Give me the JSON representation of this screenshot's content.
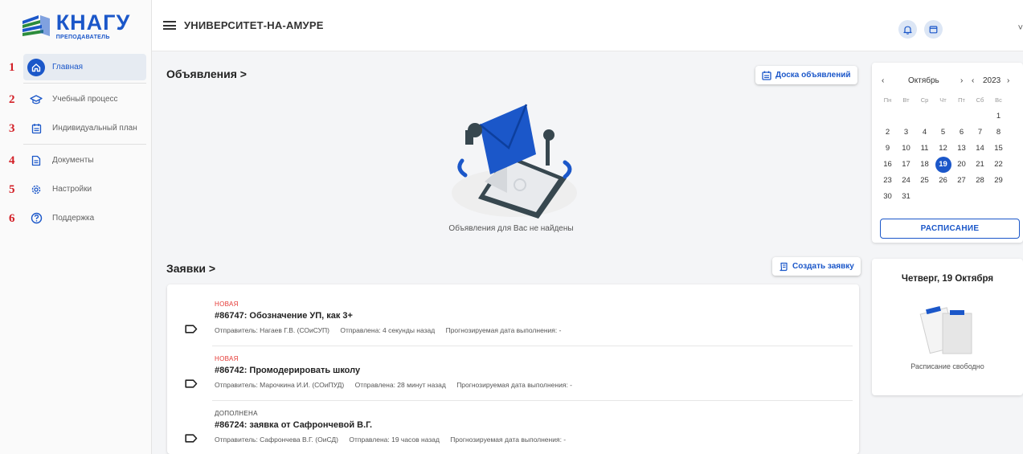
{
  "brand": {
    "logo_main": "КНАГУ",
    "logo_sub": "ПРЕПОДАВАТЕЛЬ"
  },
  "header": {
    "title": "УНИВЕРСИТЕТ-НА-АМУРЕ"
  },
  "sidebar": {
    "items": [
      {
        "num": "1",
        "label": "Главная",
        "icon": "home-icon",
        "active": true
      },
      {
        "num": "2",
        "label": "Учебный процесс",
        "icon": "graduation-cap-icon"
      },
      {
        "num": "3",
        "label": "Индивидуальный план",
        "icon": "calendar-list-icon"
      },
      {
        "num": "4",
        "label": "Документы",
        "icon": "document-icon"
      },
      {
        "num": "5",
        "label": "Настройки",
        "icon": "gear-icon"
      },
      {
        "num": "6",
        "label": "Поддержка",
        "icon": "help-icon"
      }
    ]
  },
  "announcements": {
    "title": "Объявления >",
    "board_button": "Доска объявлений",
    "empty_text": "Объявления для Вас не найдены"
  },
  "requests": {
    "title": "Заявки >",
    "create_button": "Создать заявку",
    "items": [
      {
        "status": "НОВАЯ",
        "title": "#86747: Обозначение УП, как 3+",
        "sender": "Отправитель: Нагаев Г.В. (СОиСУП)",
        "sent": "Отправлена: 4 секунды назад",
        "due": "Прогнозируемая дата выполнения: -"
      },
      {
        "status": "НОВАЯ",
        "title": "#86742: Промодерировать школу",
        "sender": "Отправитель: Марочкина И.И. (СОиПУД)",
        "sent": "Отправлена: 28 минут назад",
        "due": "Прогнозируемая дата выполнения: -"
      },
      {
        "status": "ДОПОЛНЕНА",
        "title": "#86724: заявка от Сафрончевой В.Г.",
        "sender": "Отправитель: Сафрончева В.Г. (ОиСД)",
        "sent": "Отправлена: 19 часов назад",
        "due": "Прогнозируемая дата выполнения: -"
      }
    ]
  },
  "calendar": {
    "prev": "‹",
    "month": "Октябрь",
    "month_next": "›",
    "year_prev": "‹",
    "year": "2023",
    "year_next": "›",
    "weekdays": [
      "Пн",
      "Вт",
      "Ср",
      "Чт",
      "Пт",
      "Сб",
      "Вс"
    ],
    "days": [
      "",
      "",
      "",
      "",
      "",
      "",
      "1",
      "2",
      "3",
      "4",
      "5",
      "6",
      "7",
      "8",
      "9",
      "10",
      "11",
      "12",
      "13",
      "14",
      "15",
      "16",
      "17",
      "18",
      "19",
      "20",
      "21",
      "22",
      "23",
      "24",
      "25",
      "26",
      "27",
      "28",
      "29",
      "30",
      "31"
    ],
    "selected": "19",
    "schedule_button": "РАСПИСАНИЕ"
  },
  "day": {
    "title": "Четверг, 19 Октября",
    "text": "Расписание свободно"
  },
  "colors": {
    "primary": "#1b57c9",
    "status_new": "#e53935",
    "status_updated": "#444444",
    "numbering": "#d32027"
  }
}
